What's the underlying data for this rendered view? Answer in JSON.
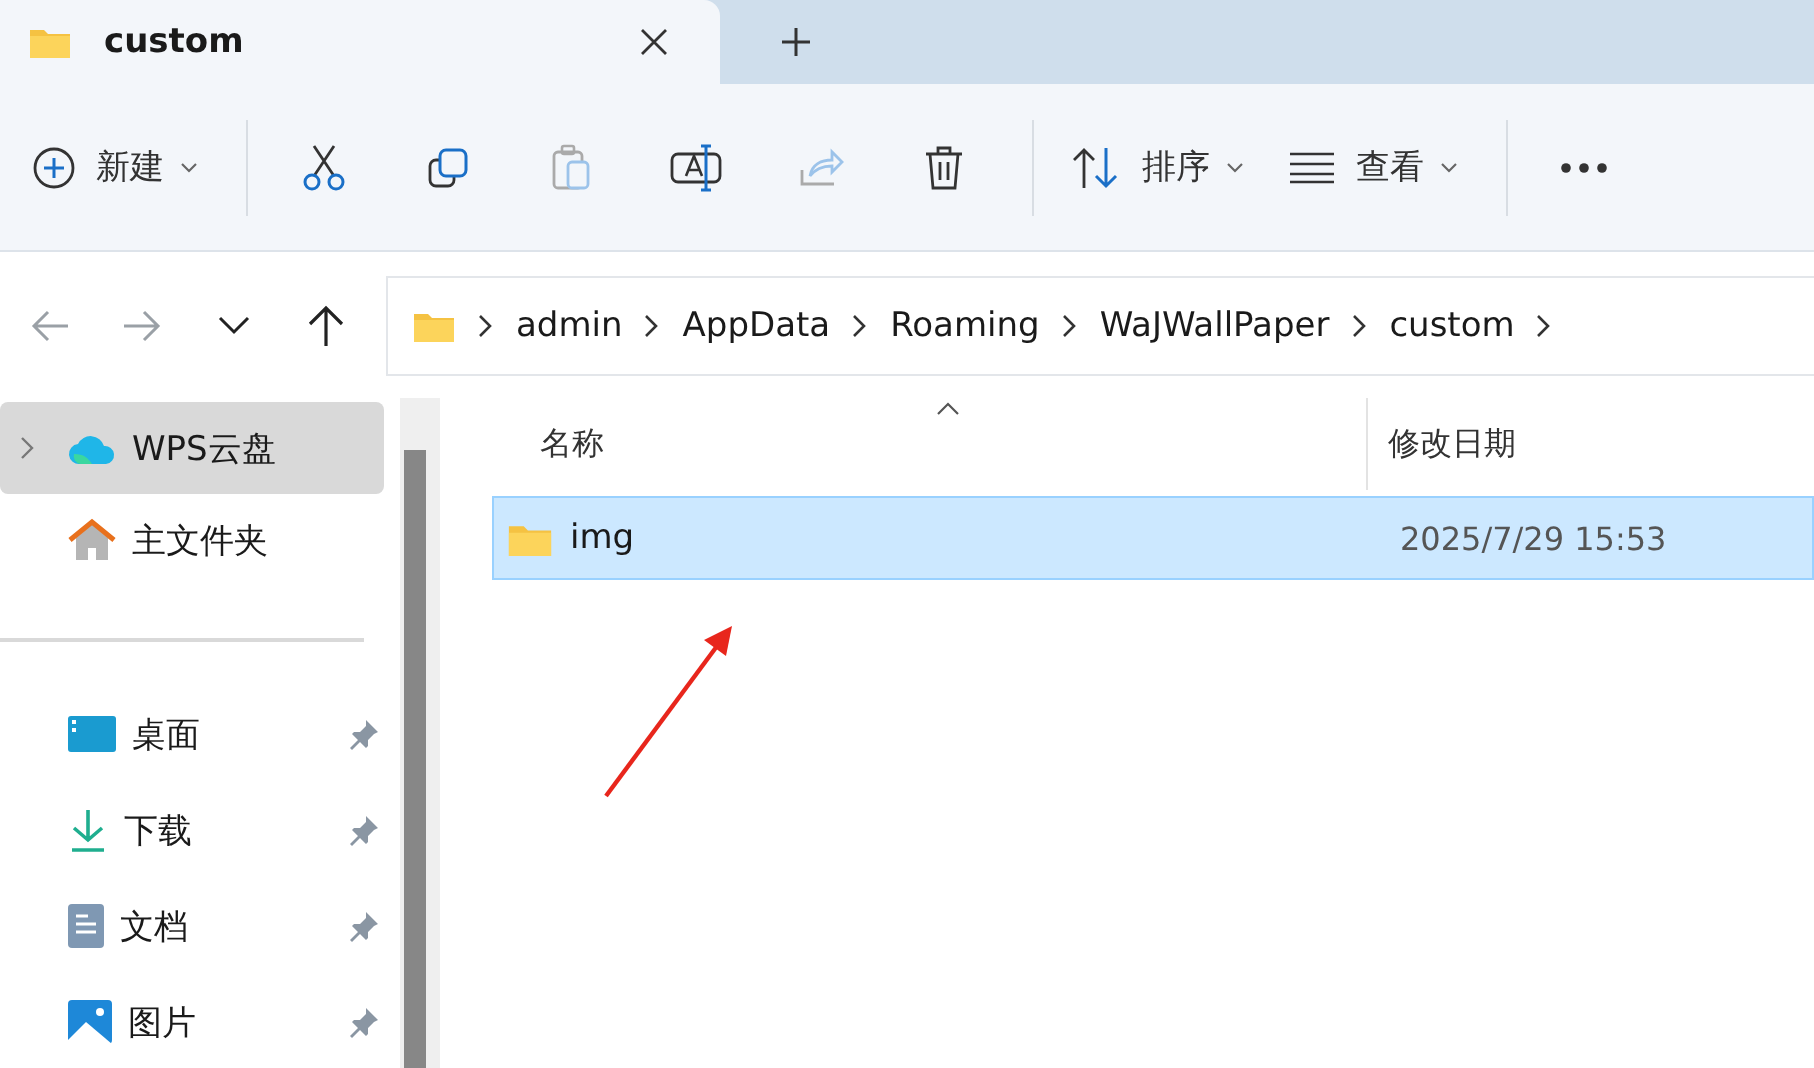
{
  "tab": {
    "title": "custom"
  },
  "toolbar": [
    {
      "kind": "new",
      "label": "新建",
      "disabled": false
    },
    {
      "kind": "cut",
      "disabled": false
    },
    {
      "kind": "copy",
      "disabled": false
    },
    {
      "kind": "paste",
      "disabled": true
    },
    {
      "kind": "rename",
      "disabled": false
    },
    {
      "kind": "share",
      "disabled": true
    },
    {
      "kind": "delete",
      "disabled": false
    },
    {
      "kind": "sort",
      "label": "排序",
      "disabled": false
    },
    {
      "kind": "view",
      "label": "查看",
      "disabled": false
    },
    {
      "kind": "more",
      "disabled": false
    }
  ],
  "nav": [
    {
      "kind": "back",
      "disabled": true
    },
    {
      "kind": "forward",
      "disabled": true
    },
    {
      "kind": "recent",
      "disabled": false
    },
    {
      "kind": "up",
      "disabled": false
    }
  ],
  "breadcrumb": [
    "admin",
    "AppData",
    "Roaming",
    "WaJWallPaper",
    "custom"
  ],
  "sidebar": {
    "top": [
      {
        "kind": "cloud",
        "label": "WPS云盘",
        "selected": true,
        "expandable": true
      },
      {
        "kind": "home",
        "label": "主文件夹",
        "selected": false,
        "expandable": false
      }
    ],
    "quick": [
      {
        "kind": "desktop",
        "label": "桌面",
        "pinned": true
      },
      {
        "kind": "download",
        "label": "下载",
        "pinned": true
      },
      {
        "kind": "documents",
        "label": "文档",
        "pinned": true
      },
      {
        "kind": "pictures",
        "label": "图片",
        "pinned": true
      }
    ]
  },
  "columns": [
    "名称",
    "修改日期"
  ],
  "files": [
    {
      "name": "img",
      "modified": "2025/7/29 15:53",
      "selected": true
    }
  ]
}
